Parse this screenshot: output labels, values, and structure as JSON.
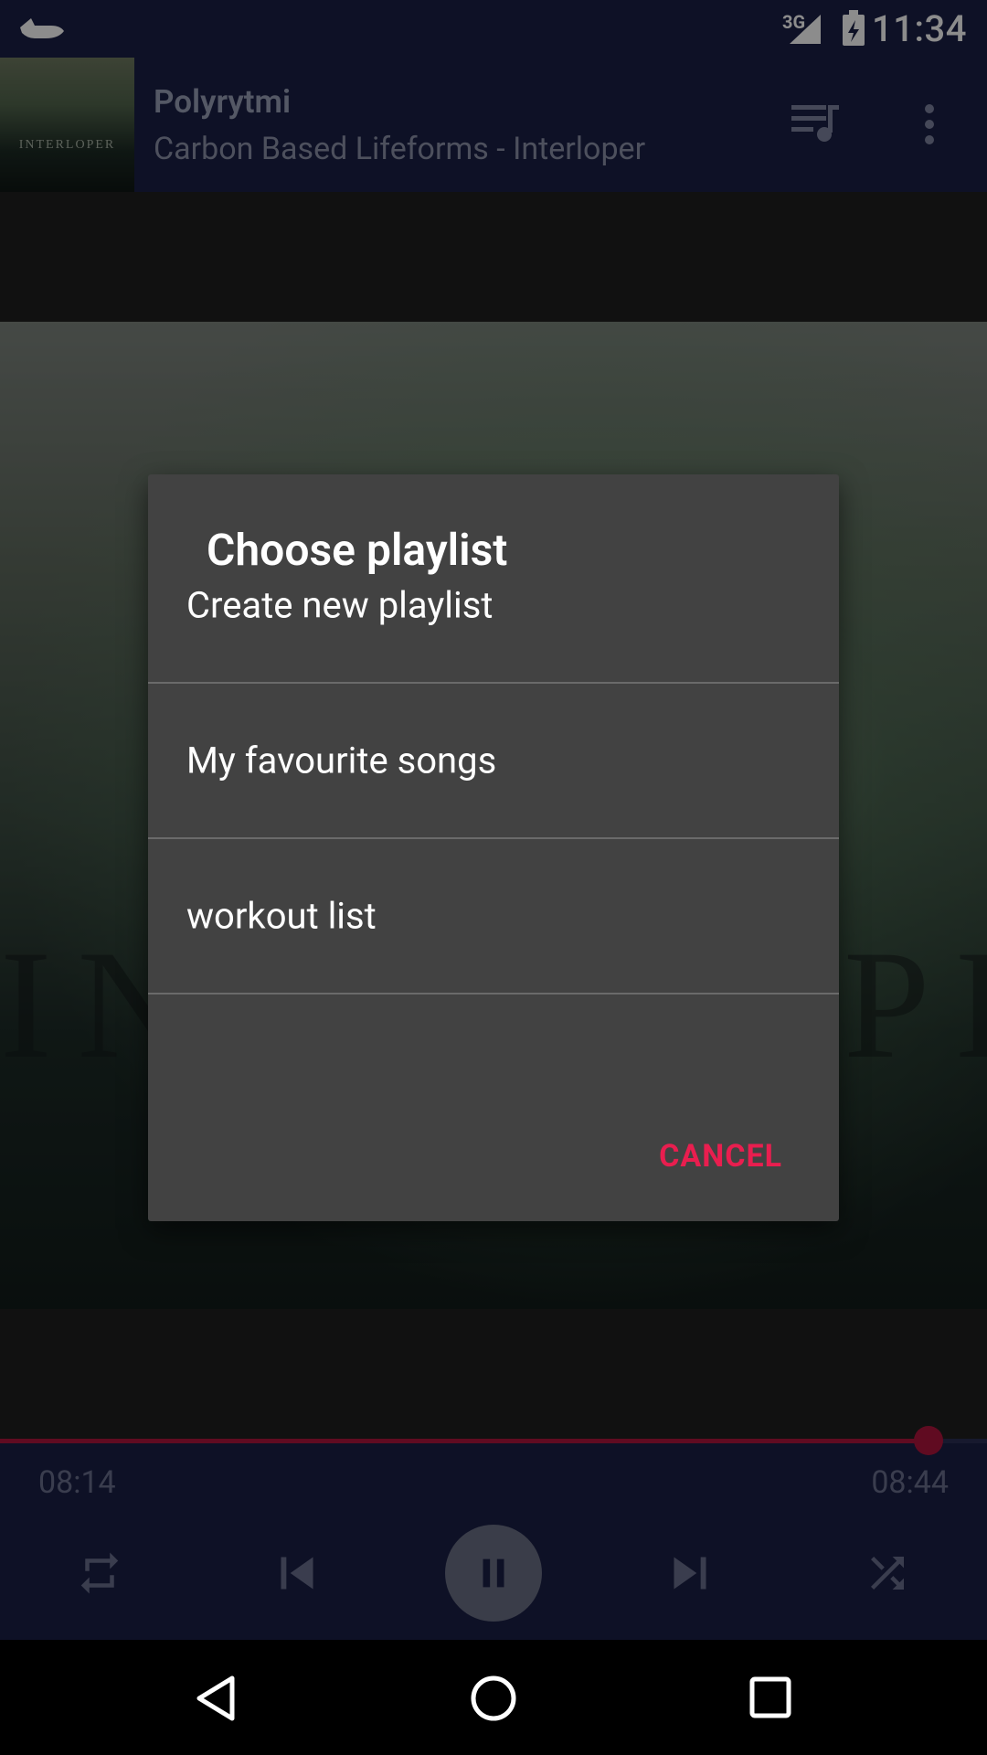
{
  "status_bar": {
    "time": "11:34",
    "network": "3G",
    "icons": [
      "app-bird-icon",
      "signal-icon",
      "battery-charging-icon"
    ]
  },
  "now_playing": {
    "title": "Polyrytmi",
    "subtitle": "Carbon Based Lifeforms - Interloper",
    "thumb_text": "INTERLOPER",
    "icons": [
      "queue-music-icon",
      "more-vert-icon"
    ]
  },
  "album_art": {
    "text": "INTERLOPER"
  },
  "player": {
    "elapsed": "08:14",
    "total": "08:44",
    "progress": 0.941,
    "accent_color": "#b0143c",
    "icons": [
      "repeat-icon",
      "skip-previous-icon",
      "pause-icon",
      "skip-next-icon",
      "shuffle-icon"
    ]
  },
  "dialog": {
    "title": "Choose playlist",
    "options": [
      "Create new playlist",
      "My favourite songs",
      "workout list"
    ],
    "cancel_label": "CANCEL",
    "cancel_color": "#e91e4f"
  },
  "nav_bar": {
    "icons": [
      "back-icon",
      "home-icon",
      "recents-icon"
    ]
  }
}
